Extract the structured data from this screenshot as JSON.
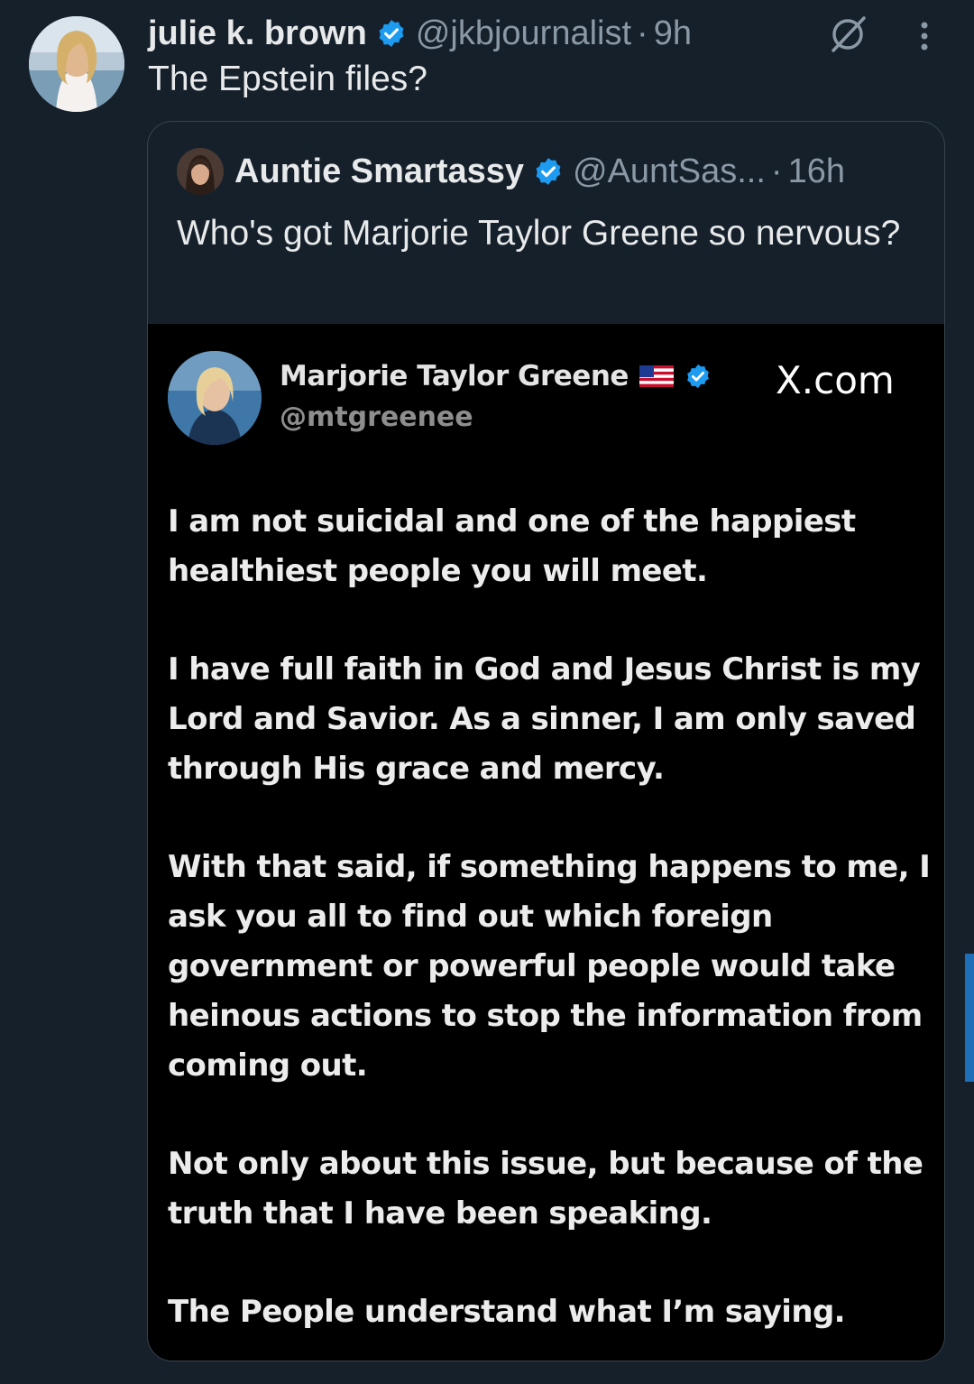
{
  "tweet": {
    "author_name": "julie k. brown",
    "handle": "@jkbjournalist",
    "separator": "·",
    "time": "9h",
    "text": "The Epstein files?",
    "verified_icon": "verified-badge-icon",
    "grok_icon": "grok-icon",
    "more_icon": "more-options-icon"
  },
  "quoted": {
    "author_name": "Auntie Smartassy",
    "handle": "@AuntSas...",
    "separator": "·",
    "time": "16h",
    "text": "Who's got Marjorie Taylor Greene so nervous?",
    "verified_icon": "verified-badge-icon"
  },
  "embedded_image": {
    "author_name": "Marjorie Taylor Greene",
    "flag_icon": "us-flag-icon",
    "handle": "@mtgreenee",
    "source": "X.com",
    "paragraphs": [
      "I am not suicidal and one of the happiest healthiest people you will meet.",
      "I have full faith in God and Jesus Christ is my Lord and Savior. As a sinner, I am only saved through His grace and mercy.",
      "With that said, if something happens to me, I ask you all to find out which foreign government or powerful people would take heinous actions to stop the information from coming out.",
      "Not only about this issue, but because of the truth that I have been speaking.",
      "The People understand what I’m saying."
    ]
  },
  "colors": {
    "background": "#15202b",
    "text": "#e7e9ea",
    "secondary": "#8b98a5",
    "verified": "#1d9bf0",
    "border": "#38444d"
  }
}
